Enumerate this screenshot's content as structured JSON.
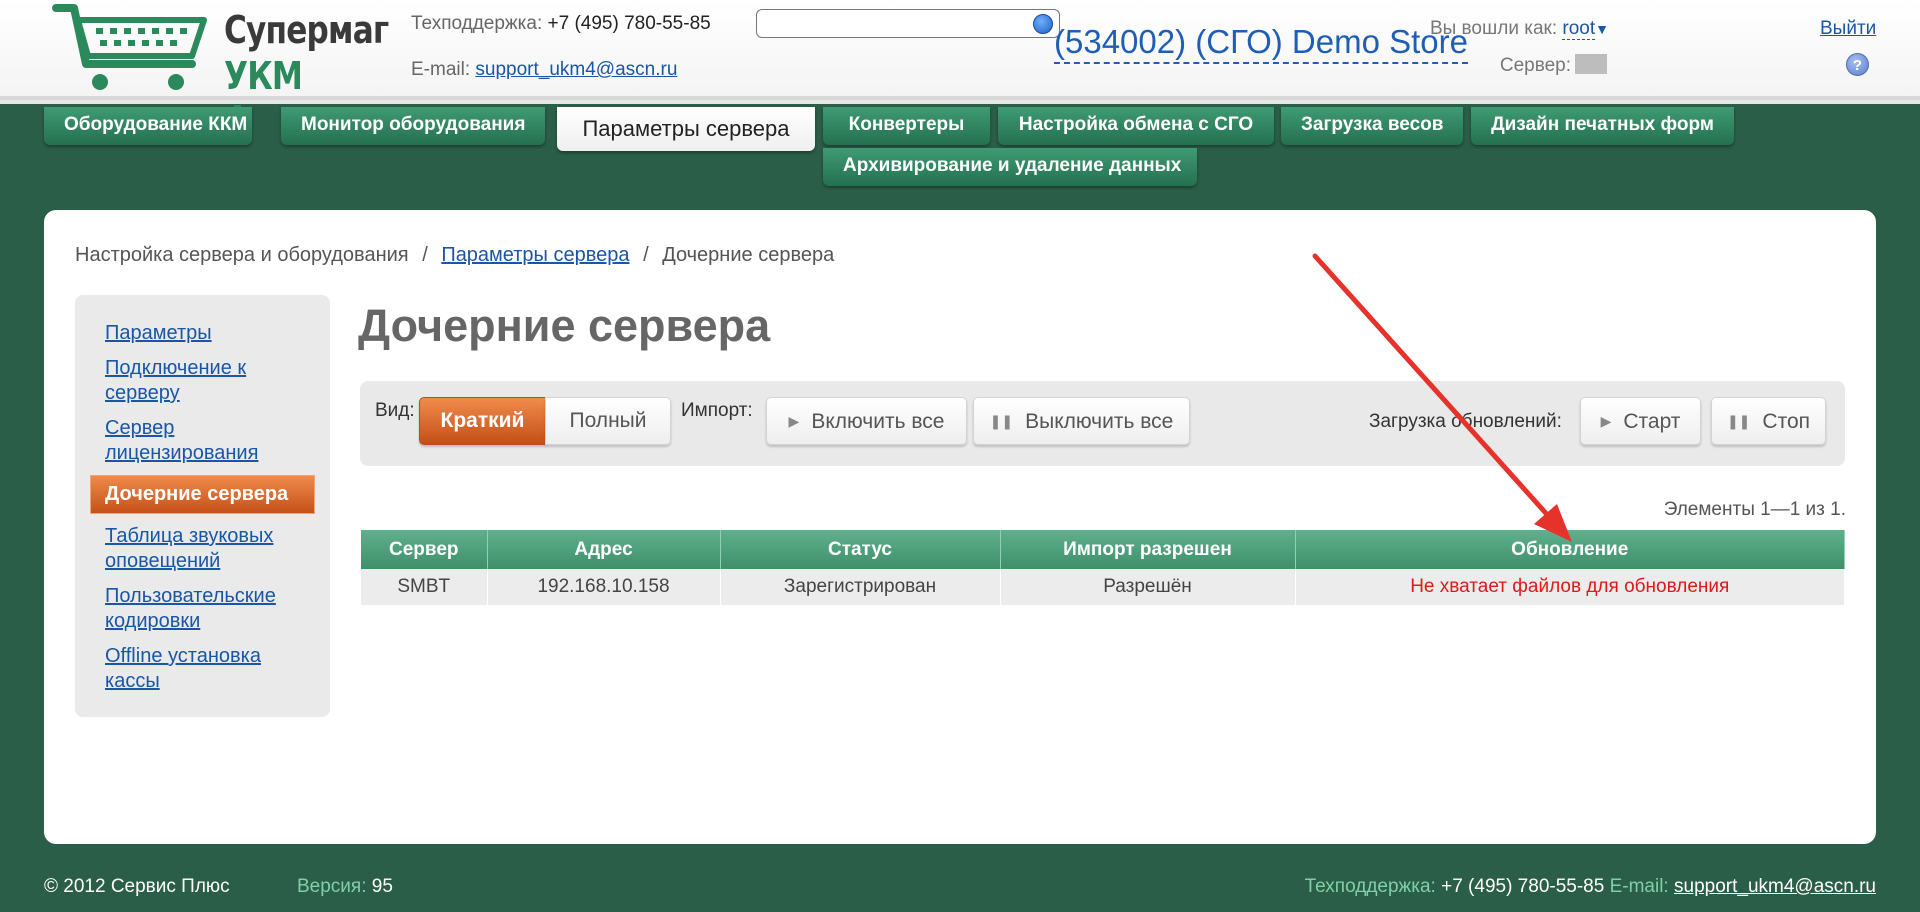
{
  "header": {
    "logo_line1": "Супермаг",
    "logo_line2": "УКМ 4",
    "support_label": "Техподдержка:",
    "support_phone": "+7 (495) 780-55-85",
    "email_label": "E-mail:",
    "email": "support_ukm4@ascn.ru",
    "search_value": "",
    "store_name": "(534002) (СГО) Demo Store",
    "logged_in_label": "Вы вошли как:",
    "user": "root",
    "logout": "Выйти",
    "server_label": "Сервер:",
    "help": "?"
  },
  "tabs": [
    {
      "label": "Оборудование ККМ"
    },
    {
      "label": "Монитор оборудования"
    },
    {
      "label": "Параметры сервера"
    },
    {
      "label": "Конвертеры"
    },
    {
      "label": "Настройка обмена с СГО"
    },
    {
      "label": "Загрузка весов"
    },
    {
      "label": "Дизайн печатных форм"
    },
    {
      "label": "Архивирование и удаление данных"
    }
  ],
  "breadcrumb": {
    "item1": "Настройка сервера и оборудования",
    "item2": "Параметры сервера",
    "item3": "Дочерние сервера",
    "sep": "/"
  },
  "sidebar": {
    "items": [
      {
        "label": "Параметры"
      },
      {
        "label": "Подключение к серверу"
      },
      {
        "label": "Сервер лицензирования"
      },
      {
        "label": "Дочерние сервера"
      },
      {
        "label": "Таблица звуковых оповещений"
      },
      {
        "label": "Пользовательские кодировки"
      },
      {
        "label": "Offline установка кассы"
      }
    ]
  },
  "page_title": "Дочерние сервера",
  "toolbar": {
    "view_label": "Вид:",
    "view_short": "Краткий",
    "view_full": "Полный",
    "import_label": "Импорт:",
    "enable_all": "Включить все",
    "disable_all": "Выключить все",
    "updates_label": "Загрузка обновлений:",
    "start": "Старт",
    "stop": "Стоп"
  },
  "count_label": "Элементы 1—1 из 1.",
  "table": {
    "columns": [
      "Сервер",
      "Адрес",
      "Статус",
      "Импорт разрешен",
      "Обновление"
    ],
    "rows": [
      [
        "SMBT",
        "192.168.10.158",
        "Зарегистрирован",
        "Разрешён",
        "Не хватает файлов для обновления"
      ]
    ]
  },
  "footer": {
    "copyright": "© 2012 Сервис Плюс",
    "version_label": "Версия:",
    "version": "95",
    "support_label": "Техподдержка:",
    "support_phone": "+7 (495) 780-55-85",
    "email_label": "E-mail:",
    "email": "support_ukm4@ascn.ru"
  },
  "colors": {
    "background": "#2b5e48",
    "tab_green": "#3e8f6a",
    "accent_orange": "#e06a2a",
    "link_blue": "#1a56a6",
    "error_red": "#e01818",
    "arrow_red": "#e5322b"
  }
}
